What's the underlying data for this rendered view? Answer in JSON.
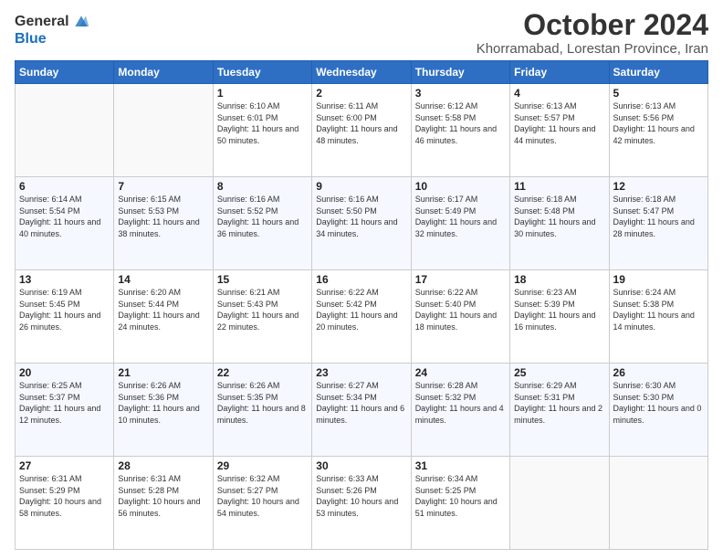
{
  "logo": {
    "general": "General",
    "blue": "Blue"
  },
  "title": "October 2024",
  "location": "Khorramabad, Lorestan Province, Iran",
  "days_of_week": [
    "Sunday",
    "Monday",
    "Tuesday",
    "Wednesday",
    "Thursday",
    "Friday",
    "Saturday"
  ],
  "weeks": [
    [
      {
        "day": "",
        "info": ""
      },
      {
        "day": "",
        "info": ""
      },
      {
        "day": "1",
        "info": "Sunrise: 6:10 AM\nSunset: 6:01 PM\nDaylight: 11 hours and 50 minutes."
      },
      {
        "day": "2",
        "info": "Sunrise: 6:11 AM\nSunset: 6:00 PM\nDaylight: 11 hours and 48 minutes."
      },
      {
        "day": "3",
        "info": "Sunrise: 6:12 AM\nSunset: 5:58 PM\nDaylight: 11 hours and 46 minutes."
      },
      {
        "day": "4",
        "info": "Sunrise: 6:13 AM\nSunset: 5:57 PM\nDaylight: 11 hours and 44 minutes."
      },
      {
        "day": "5",
        "info": "Sunrise: 6:13 AM\nSunset: 5:56 PM\nDaylight: 11 hours and 42 minutes."
      }
    ],
    [
      {
        "day": "6",
        "info": "Sunrise: 6:14 AM\nSunset: 5:54 PM\nDaylight: 11 hours and 40 minutes."
      },
      {
        "day": "7",
        "info": "Sunrise: 6:15 AM\nSunset: 5:53 PM\nDaylight: 11 hours and 38 minutes."
      },
      {
        "day": "8",
        "info": "Sunrise: 6:16 AM\nSunset: 5:52 PM\nDaylight: 11 hours and 36 minutes."
      },
      {
        "day": "9",
        "info": "Sunrise: 6:16 AM\nSunset: 5:50 PM\nDaylight: 11 hours and 34 minutes."
      },
      {
        "day": "10",
        "info": "Sunrise: 6:17 AM\nSunset: 5:49 PM\nDaylight: 11 hours and 32 minutes."
      },
      {
        "day": "11",
        "info": "Sunrise: 6:18 AM\nSunset: 5:48 PM\nDaylight: 11 hours and 30 minutes."
      },
      {
        "day": "12",
        "info": "Sunrise: 6:18 AM\nSunset: 5:47 PM\nDaylight: 11 hours and 28 minutes."
      }
    ],
    [
      {
        "day": "13",
        "info": "Sunrise: 6:19 AM\nSunset: 5:45 PM\nDaylight: 11 hours and 26 minutes."
      },
      {
        "day": "14",
        "info": "Sunrise: 6:20 AM\nSunset: 5:44 PM\nDaylight: 11 hours and 24 minutes."
      },
      {
        "day": "15",
        "info": "Sunrise: 6:21 AM\nSunset: 5:43 PM\nDaylight: 11 hours and 22 minutes."
      },
      {
        "day": "16",
        "info": "Sunrise: 6:22 AM\nSunset: 5:42 PM\nDaylight: 11 hours and 20 minutes."
      },
      {
        "day": "17",
        "info": "Sunrise: 6:22 AM\nSunset: 5:40 PM\nDaylight: 11 hours and 18 minutes."
      },
      {
        "day": "18",
        "info": "Sunrise: 6:23 AM\nSunset: 5:39 PM\nDaylight: 11 hours and 16 minutes."
      },
      {
        "day": "19",
        "info": "Sunrise: 6:24 AM\nSunset: 5:38 PM\nDaylight: 11 hours and 14 minutes."
      }
    ],
    [
      {
        "day": "20",
        "info": "Sunrise: 6:25 AM\nSunset: 5:37 PM\nDaylight: 11 hours and 12 minutes."
      },
      {
        "day": "21",
        "info": "Sunrise: 6:26 AM\nSunset: 5:36 PM\nDaylight: 11 hours and 10 minutes."
      },
      {
        "day": "22",
        "info": "Sunrise: 6:26 AM\nSunset: 5:35 PM\nDaylight: 11 hours and 8 minutes."
      },
      {
        "day": "23",
        "info": "Sunrise: 6:27 AM\nSunset: 5:34 PM\nDaylight: 11 hours and 6 minutes."
      },
      {
        "day": "24",
        "info": "Sunrise: 6:28 AM\nSunset: 5:32 PM\nDaylight: 11 hours and 4 minutes."
      },
      {
        "day": "25",
        "info": "Sunrise: 6:29 AM\nSunset: 5:31 PM\nDaylight: 11 hours and 2 minutes."
      },
      {
        "day": "26",
        "info": "Sunrise: 6:30 AM\nSunset: 5:30 PM\nDaylight: 11 hours and 0 minutes."
      }
    ],
    [
      {
        "day": "27",
        "info": "Sunrise: 6:31 AM\nSunset: 5:29 PM\nDaylight: 10 hours and 58 minutes."
      },
      {
        "day": "28",
        "info": "Sunrise: 6:31 AM\nSunset: 5:28 PM\nDaylight: 10 hours and 56 minutes."
      },
      {
        "day": "29",
        "info": "Sunrise: 6:32 AM\nSunset: 5:27 PM\nDaylight: 10 hours and 54 minutes."
      },
      {
        "day": "30",
        "info": "Sunrise: 6:33 AM\nSunset: 5:26 PM\nDaylight: 10 hours and 53 minutes."
      },
      {
        "day": "31",
        "info": "Sunrise: 6:34 AM\nSunset: 5:25 PM\nDaylight: 10 hours and 51 minutes."
      },
      {
        "day": "",
        "info": ""
      },
      {
        "day": "",
        "info": ""
      }
    ]
  ]
}
